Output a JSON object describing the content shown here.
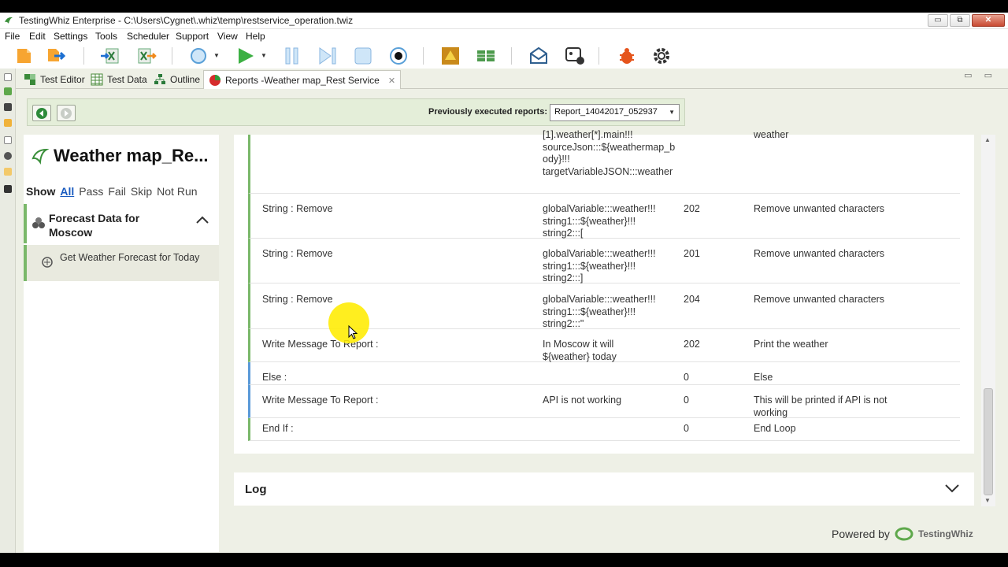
{
  "window": {
    "title": "TestingWhiz Enterprise - C:\\Users\\Cygnet\\.whiz\\temp\\restservice_operation.twiz",
    "btn_min": "▭",
    "btn_max": "⧉",
    "btn_close": "✕"
  },
  "menu": [
    "File",
    "Edit",
    "Settings",
    "Tools",
    "Scheduler",
    "Support",
    "View",
    "Help"
  ],
  "toolbar_icons": [
    "new-file-icon",
    "open-file-icon",
    "excel-import-icon",
    "excel-export-icon",
    "browser-select-icon",
    "run-icon",
    "pause-icon",
    "step-icon",
    "stop-icon",
    "record-icon",
    "objects-icon",
    "data-table-icon",
    "email-icon",
    "bot-icon",
    "debug-icon",
    "settings-icon"
  ],
  "tabs": [
    {
      "label": "Test Editor"
    },
    {
      "label": "Test Data"
    },
    {
      "label": "Outline"
    },
    {
      "label": "Reports  -Weather map_Rest Service"
    }
  ],
  "tab_controls": "▭ ▭",
  "reportbar": {
    "label": "Previously executed reports:",
    "selected": "Report_14042017_052937"
  },
  "sidebar": {
    "title": "Weather map_Re...",
    "filters": {
      "show": "Show",
      "all": "All",
      "pass": "Pass",
      "fail": "Fail",
      "skip": "Skip",
      "not_run": "Not Run"
    },
    "group": {
      "label": "Forecast Data for Moscow"
    },
    "item": {
      "label": "Get Weather Forecast for Today"
    }
  },
  "rows": [
    {
      "command": "",
      "params": "[1].weather[*].main!!!\nsourceJson:::${weathermap_body}!!!\ntargetVariableJSON:::weather",
      "code": "",
      "desc": "weather"
    },
    {
      "command": "String : Remove",
      "params": "globalVariable:::weather!!!\nstring1:::${weather}!!!\nstring2:::[",
      "code": "202",
      "desc": "Remove unwanted characters"
    },
    {
      "command": "String : Remove",
      "params": "globalVariable:::weather!!!\nstring1:::${weather}!!!\nstring2:::]",
      "code": "201",
      "desc": "Remove unwanted characters"
    },
    {
      "command": "String : Remove",
      "params": "globalVariable:::weather!!!\nstring1:::${weather}!!!\nstring2:::\"",
      "code": "204",
      "desc": "Remove unwanted characters"
    },
    {
      "command": "Write Message To Report :",
      "params": "In Moscow it will\n${weather} today",
      "code": "202",
      "desc": "Print the weather"
    },
    {
      "command": "Else :",
      "params": "",
      "code": "0",
      "desc": "Else"
    },
    {
      "command": "Write Message To Report :",
      "params": "API is not working",
      "code": "0",
      "desc": "This will be printed if API is not working"
    },
    {
      "command": "End If :",
      "params": "",
      "code": "0",
      "desc": "End Loop"
    }
  ],
  "log": {
    "title": "Log"
  },
  "footer": {
    "powered_by": "Powered by",
    "brand": "TestingWhiz"
  },
  "colors": {
    "accent_green": "#7ab86a",
    "accent_blue": "#5a9ad8",
    "panel_bg": "#eef0e6"
  }
}
